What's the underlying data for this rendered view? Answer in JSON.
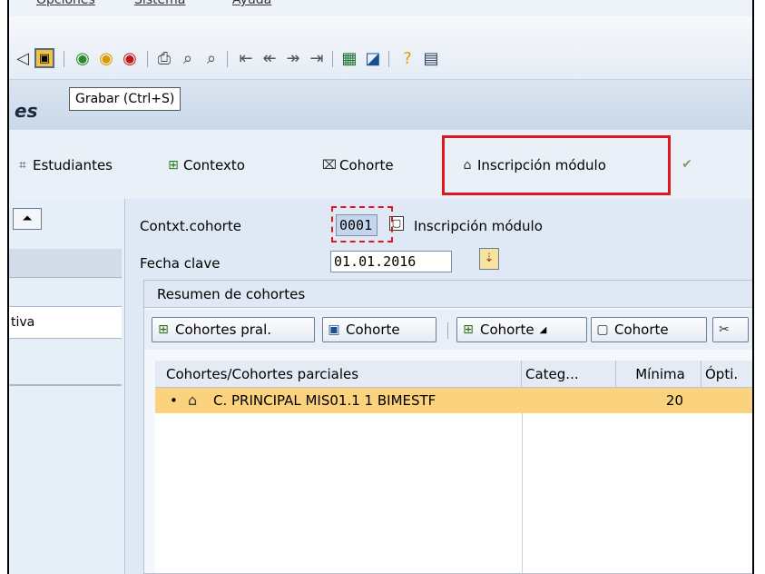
{
  "menu": {
    "items": [
      "Opciones",
      "Sistema",
      "Ayuda"
    ]
  },
  "toolbar": {
    "icons": [
      "back-arrow-icon",
      "save-icon",
      "green-back-icon",
      "exit-icon",
      "cancel-icon",
      "print-icon",
      "find-icon",
      "find-next-icon",
      "first-page-icon",
      "prev-page-icon",
      "next-page-icon",
      "last-page-icon",
      "new-session-icon",
      "shortcut-icon",
      "help-icon",
      "layout-icon"
    ]
  },
  "tooltip": {
    "text": "Grabar  (Ctrl+S)"
  },
  "title": {
    "text": "es"
  },
  "app_toolbar": {
    "estudiantes": "Estudiantes",
    "contexto": "Contexto",
    "cohorte": "Cohorte",
    "inscripcion": "Inscripción módulo"
  },
  "form": {
    "contexto_label": "Contxt.cohorte",
    "contexto_value": "0001",
    "contexto_desc": "Inscripción módulo",
    "fecha_label": "Fecha clave",
    "fecha_value": "01.01.2016"
  },
  "left_panel": {
    "row_text": "tiva"
  },
  "cohort_panel": {
    "title": "Resumen de cohortes",
    "buttons": {
      "cohortes_pral": "Cohortes pral.",
      "cohorte1": "Cohorte",
      "cohorte2": "Cohorte",
      "cohorte3": "Cohorte"
    },
    "columns": [
      "Cohortes/Cohortes parciales",
      "Categ...",
      "Mínima",
      "Ópti."
    ],
    "rows": [
      {
        "name": "C. PRINCIPAL MIS01.1 1 BIMESTF",
        "categ": "",
        "minima": "20",
        "opti": ""
      }
    ]
  },
  "colors": {
    "highlight": "#e0161d",
    "selected_row": "#fbd27d"
  }
}
